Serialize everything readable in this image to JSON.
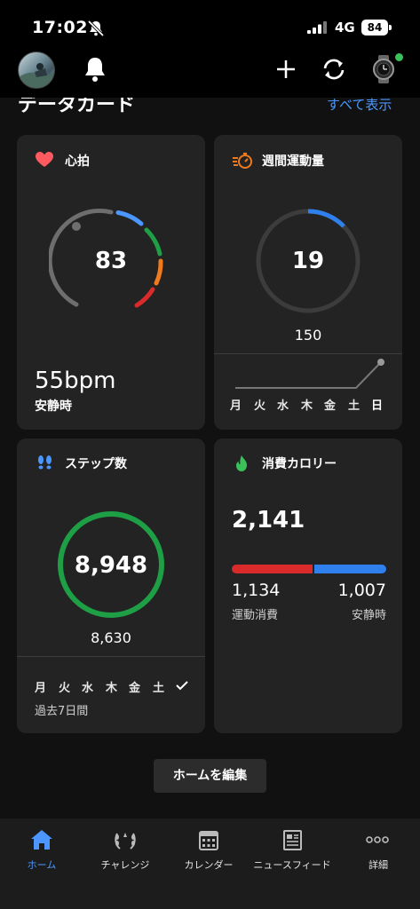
{
  "status": {
    "time": "17:02",
    "network": "4G",
    "battery": "84"
  },
  "section": {
    "title": "データカード",
    "see_all": "すべて表示"
  },
  "heart": {
    "title": "心拍",
    "value": "83",
    "bpm": "55bpm",
    "label": "安静時"
  },
  "weekly": {
    "title": "週間運動量",
    "value": "19",
    "goal": "150",
    "progress": 0.127,
    "days": [
      "月",
      "火",
      "水",
      "木",
      "金",
      "土",
      "日"
    ],
    "trend": [
      0,
      0,
      0,
      0,
      0,
      0,
      1
    ]
  },
  "steps": {
    "title": "ステップ数",
    "value": "8,948",
    "goal": "8,630",
    "days": [
      "月",
      "火",
      "水",
      "木",
      "金",
      "土"
    ],
    "period": "過去7日間"
  },
  "calories": {
    "title": "消費カロリー",
    "total": "2,141",
    "active": "1,134",
    "active_label": "運動消費",
    "resting": "1,007",
    "resting_label": "安静時",
    "active_fraction": 0.53
  },
  "edit_home": "ホームを編集",
  "tabs": [
    {
      "label": "ホーム",
      "icon": "home-icon",
      "active": true
    },
    {
      "label": "チャレンジ",
      "icon": "laurel-icon",
      "active": false
    },
    {
      "label": "カレンダー",
      "icon": "calendar-icon",
      "active": false
    },
    {
      "label": "ニュースフィード",
      "icon": "news-icon",
      "active": false
    },
    {
      "label": "詳細",
      "icon": "more-icon",
      "active": false
    }
  ],
  "colors": {
    "accent": "#4b97ff",
    "heart": "#ff5a5f",
    "steps_ring": "#1e9e45",
    "active_cal": "#d92b2b",
    "resting_cal": "#2f80ed"
  }
}
